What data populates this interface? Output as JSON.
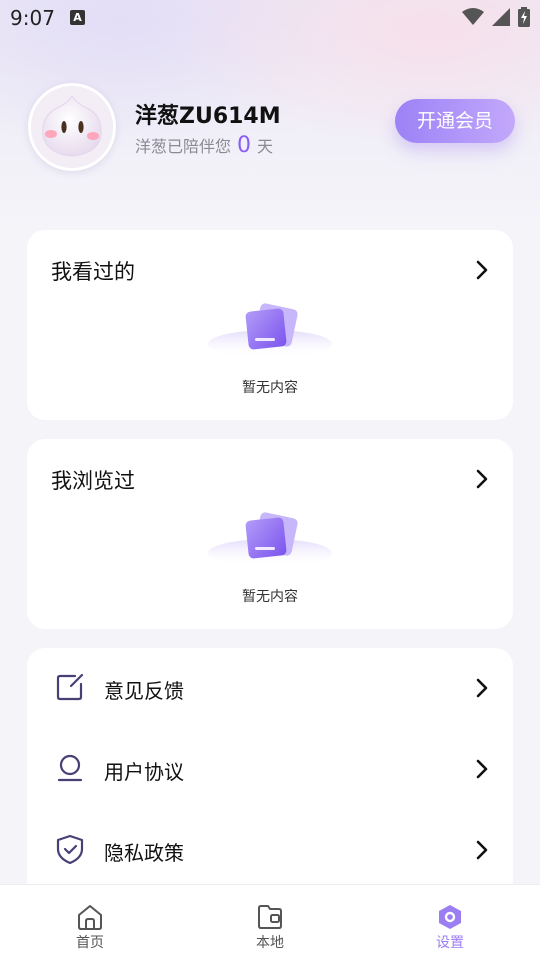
{
  "status_bar": {
    "time": "9:07",
    "notification_icon": "A"
  },
  "profile": {
    "nickname": "洋葱ZU614M",
    "companion_prefix": "洋葱已陪伴您",
    "companion_days": "0",
    "companion_suffix": "天",
    "vip_button": "开通会员"
  },
  "watched": {
    "title": "我看过的",
    "empty_text": "暂无内容"
  },
  "browsed": {
    "title": "我浏览过",
    "empty_text": "暂无内容"
  },
  "menu": {
    "items": [
      {
        "label": "意见反馈",
        "icon": "feedback-icon"
      },
      {
        "label": "用户协议",
        "icon": "user-agreement-icon"
      },
      {
        "label": "隐私政策",
        "icon": "privacy-shield-icon"
      }
    ]
  },
  "tabbar": {
    "tabs": [
      {
        "label": "首页",
        "icon": "home-icon",
        "active": false
      },
      {
        "label": "本地",
        "icon": "local-folder-icon",
        "active": false
      },
      {
        "label": "设置",
        "icon": "settings-icon",
        "active": true
      }
    ]
  },
  "colors": {
    "accent": "#9c7ef3",
    "vip_gradient_start": "#9b82f6",
    "vip_gradient_end": "#c3a8fb",
    "page_background": "#f4f4f9"
  }
}
